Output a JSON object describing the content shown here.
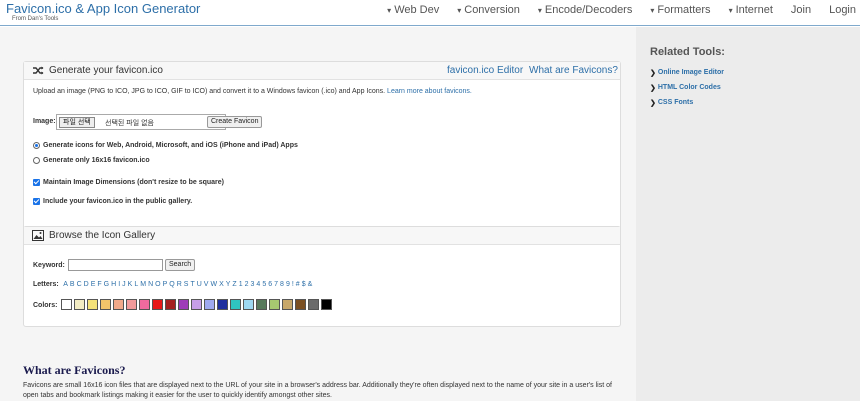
{
  "header": {
    "title": "Favicon.ico & App Icon Generator",
    "subtitle": "From Dan's Tools",
    "nav": [
      {
        "label": "Web Dev",
        "caret": true
      },
      {
        "label": "Conversion",
        "caret": true
      },
      {
        "label": "Encode/Decoders",
        "caret": true
      },
      {
        "label": "Formatters",
        "caret": true
      },
      {
        "label": "Internet",
        "caret": true
      },
      {
        "label": "Join",
        "caret": false
      },
      {
        "label": "Login",
        "caret": false
      }
    ]
  },
  "generate": {
    "title": "Generate your favicon.ico",
    "link_editor": "favicon.ico Editor",
    "link_what": "What are Favicons?",
    "intro": "Upload an image (PNG to ICO, JPG to ICO, GIF to ICO) and convert it to a Windows favicon (.ico) and App Icons.",
    "learn_more": "Learn more about favicons.",
    "image_label": "Image:",
    "file_button": "파일 선택",
    "file_status": "선택된 파일 없음",
    "create_button": "Create Favicon",
    "option_all": "Generate icons for Web, Android, Microsoft, and iOS (iPhone and iPad) Apps",
    "option_only": "Generate only 16x16 favicon.ico",
    "maintain": "Maintain Image Dimensions (don't resize to be square)",
    "include": "Include your favicon.ico in the public gallery."
  },
  "gallery": {
    "title": "Browse the Icon Gallery",
    "keyword_label": "Keyword:",
    "keyword_value": "",
    "search_button": "Search",
    "letters_label": "Letters:",
    "letters": [
      "A",
      "B",
      "C",
      "D",
      "E",
      "F",
      "G",
      "H",
      "I",
      "J",
      "K",
      "L",
      "M",
      "N",
      "O",
      "P",
      "Q",
      "R",
      "S",
      "T",
      "U",
      "V",
      "W",
      "X",
      "Y",
      "Z",
      "1",
      "2",
      "3",
      "4",
      "5",
      "6",
      "7",
      "8",
      "9",
      "!",
      "#",
      "$",
      "&"
    ],
    "colors_label": "Colors:",
    "colors": [
      "#ffffff",
      "#f3ecc3",
      "#f5e27a",
      "#f2c46a",
      "#f2a98a",
      "#f29b9b",
      "#f06a9e",
      "#e81818",
      "#a52020",
      "#9e3cb8",
      "#c79ee8",
      "#9fa9ef",
      "#1f2f9e",
      "#2fc4c0",
      "#9ed8f2",
      "#57795c",
      "#a6c870",
      "#c8a86a",
      "#7a4f22",
      "#6b6b6b",
      "#000000"
    ]
  },
  "favicons": {
    "title": "What are Favicons?",
    "text": "Favicons are small 16x16 icon files that are displayed next to the URL of your site in a browser's address bar. Additionally they're often displayed next to the name of your site in a user's list of open tabs and bookmark listings making it easier for the user to quickly identify amongst other sites."
  },
  "sidebar": {
    "title": "Related Tools:",
    "items": [
      "Online Image Editor",
      "HTML Color Codes",
      "CSS Fonts"
    ]
  }
}
